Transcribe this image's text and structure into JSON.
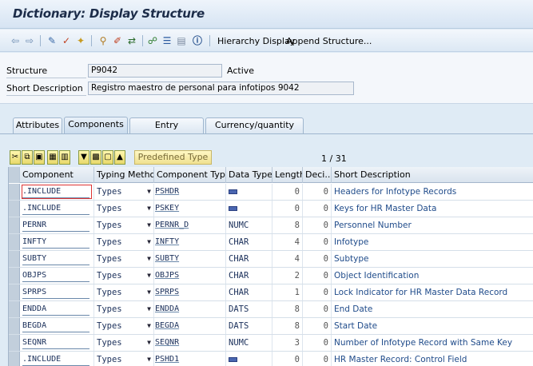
{
  "title": "Dictionary: Display Structure",
  "toolbar": {
    "hierarchy_display": "Hierarchy Display",
    "append_structure": "Append Structure..."
  },
  "header": {
    "structure_label": "Structure",
    "structure_value": "P9042",
    "status": "Active",
    "short_desc_label": "Short Description",
    "short_desc_value": "Registro maestro de personal para infotipos 9042"
  },
  "tabs": [
    {
      "label": "Attributes"
    },
    {
      "label": "Components",
      "active": true
    },
    {
      "label": "Entry help/check"
    },
    {
      "label": "Currency/quantity fields"
    }
  ],
  "table_toolbar": {
    "predefined_type": "Predefined Type"
  },
  "pager": {
    "current": "1",
    "sep": "/",
    "total": "31"
  },
  "columns": [
    "Component",
    "Typing Method",
    "Component Type",
    "Data Type",
    "Length",
    "Deci...",
    "Short Description"
  ],
  "rows": [
    {
      "component": ".INCLUDE",
      "typing": "Types",
      "ctype": "PSHDR",
      "dtype": "",
      "dtype_icon": true,
      "length": "0",
      "decimals": "0",
      "desc": "Headers for Infotype Records"
    },
    {
      "component": ".INCLUDE",
      "typing": "Types",
      "ctype": "PSKEY",
      "dtype": "",
      "dtype_icon": true,
      "length": "0",
      "decimals": "0",
      "desc": "Keys for HR Master Data"
    },
    {
      "component": "PERNR",
      "typing": "Types",
      "ctype": "PERNR_D",
      "dtype": "NUMC",
      "dtype_icon": false,
      "length": "8",
      "decimals": "0",
      "desc": "Personnel Number"
    },
    {
      "component": "INFTY",
      "typing": "Types",
      "ctype": "INFTY",
      "dtype": "CHAR",
      "dtype_icon": false,
      "length": "4",
      "decimals": "0",
      "desc": "Infotype"
    },
    {
      "component": "SUBTY",
      "typing": "Types",
      "ctype": "SUBTY",
      "dtype": "CHAR",
      "dtype_icon": false,
      "length": "4",
      "decimals": "0",
      "desc": "Subtype"
    },
    {
      "component": "OBJPS",
      "typing": "Types",
      "ctype": "OBJPS",
      "dtype": "CHAR",
      "dtype_icon": false,
      "length": "2",
      "decimals": "0",
      "desc": "Object Identification"
    },
    {
      "component": "SPRPS",
      "typing": "Types",
      "ctype": "SPRPS",
      "dtype": "CHAR",
      "dtype_icon": false,
      "length": "1",
      "decimals": "0",
      "desc": "Lock Indicator for HR Master Data Record"
    },
    {
      "component": "ENDDA",
      "typing": "Types",
      "ctype": "ENDDA",
      "dtype": "DATS",
      "dtype_icon": false,
      "length": "8",
      "decimals": "0",
      "desc": "End Date"
    },
    {
      "component": "BEGDA",
      "typing": "Types",
      "ctype": "BEGDA",
      "dtype": "DATS",
      "dtype_icon": false,
      "length": "8",
      "decimals": "0",
      "desc": "Start Date"
    },
    {
      "component": "SEQNR",
      "typing": "Types",
      "ctype": "SEQNR",
      "dtype": "NUMC",
      "dtype_icon": false,
      "length": "3",
      "decimals": "0",
      "desc": "Number of Infotype Record with Same Key"
    },
    {
      "component": ".INCLUDE",
      "typing": "Types",
      "ctype": "PSHD1",
      "dtype": "",
      "dtype_icon": true,
      "length": "0",
      "decimals": "0",
      "desc": "HR Master Record: Control Field"
    }
  ]
}
